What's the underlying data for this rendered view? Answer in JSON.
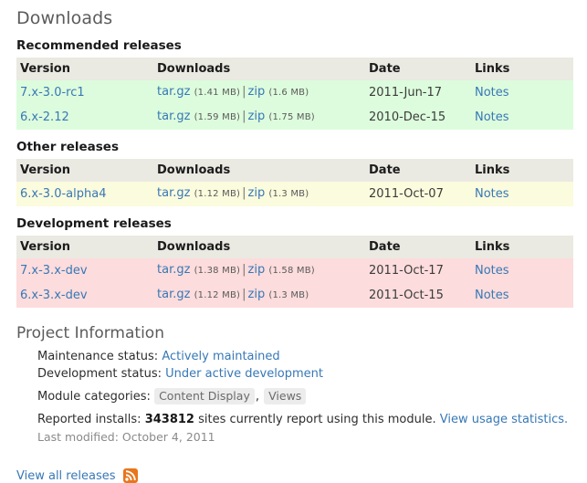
{
  "page": {
    "title": "Downloads"
  },
  "table_headers": {
    "version": "Version",
    "downloads": "Downloads",
    "date": "Date",
    "links": "Links"
  },
  "sections": [
    {
      "id": "recommended",
      "title": "Recommended releases",
      "row_color": "#ddfcdd",
      "rows": [
        {
          "version": "7.x-3.0-rc1",
          "targz_label": "tar.gz",
          "targz_size": "(1.41 MB)",
          "separator": "|",
          "zip_label": "zip",
          "zip_size": "(1.6 MB)",
          "date": "2011-Jun-17",
          "links": "Notes"
        },
        {
          "version": "6.x-2.12",
          "targz_label": "tar.gz",
          "targz_size": "(1.59 MB)",
          "separator": "|",
          "zip_label": "zip",
          "zip_size": "(1.75 MB)",
          "date": "2010-Dec-15",
          "links": "Notes"
        }
      ]
    },
    {
      "id": "other",
      "title": "Other releases",
      "row_color": "#fbfbdd",
      "rows": [
        {
          "version": "6.x-3.0-alpha4",
          "targz_label": "tar.gz",
          "targz_size": "(1.12 MB)",
          "separator": "|",
          "zip_label": "zip",
          "zip_size": "(1.3 MB)",
          "date": "2011-Oct-07",
          "links": "Notes"
        }
      ]
    },
    {
      "id": "development",
      "title": "Development releases",
      "row_color": "#fcdcdc",
      "rows": [
        {
          "version": "7.x-3.x-dev",
          "targz_label": "tar.gz",
          "targz_size": "(1.38 MB)",
          "separator": "|",
          "zip_label": "zip",
          "zip_size": "(1.58 MB)",
          "date": "2011-Oct-17",
          "links": "Notes"
        },
        {
          "version": "6.x-3.x-dev",
          "targz_label": "tar.gz",
          "targz_size": "(1.12 MB)",
          "separator": "|",
          "zip_label": "zip",
          "zip_size": "(1.3 MB)",
          "date": "2011-Oct-15",
          "links": "Notes"
        }
      ]
    }
  ],
  "project_information": {
    "title": "Project Information",
    "maintenance_label": "Maintenance status:",
    "maintenance_value": "Actively maintained",
    "development_label": "Development status:",
    "development_value": "Under active development",
    "categories_label": "Module categories:",
    "categories": [
      "Content Display",
      "Views"
    ],
    "categories_separator": ",",
    "installs_label": "Reported installs:",
    "installs_count": "343812",
    "installs_suffix": "sites currently report using this module.",
    "usage_link": "View usage statistics.",
    "last_modified": "Last modified: October 4, 2011"
  },
  "footer": {
    "view_all_label": "View all releases",
    "rss_icon_name": "rss-feed-icon",
    "rss_color": "#e8761b"
  },
  "colors": {
    "link": "#3778b6",
    "header_bg": "#eae9e2",
    "text": "#3b3b3b"
  }
}
